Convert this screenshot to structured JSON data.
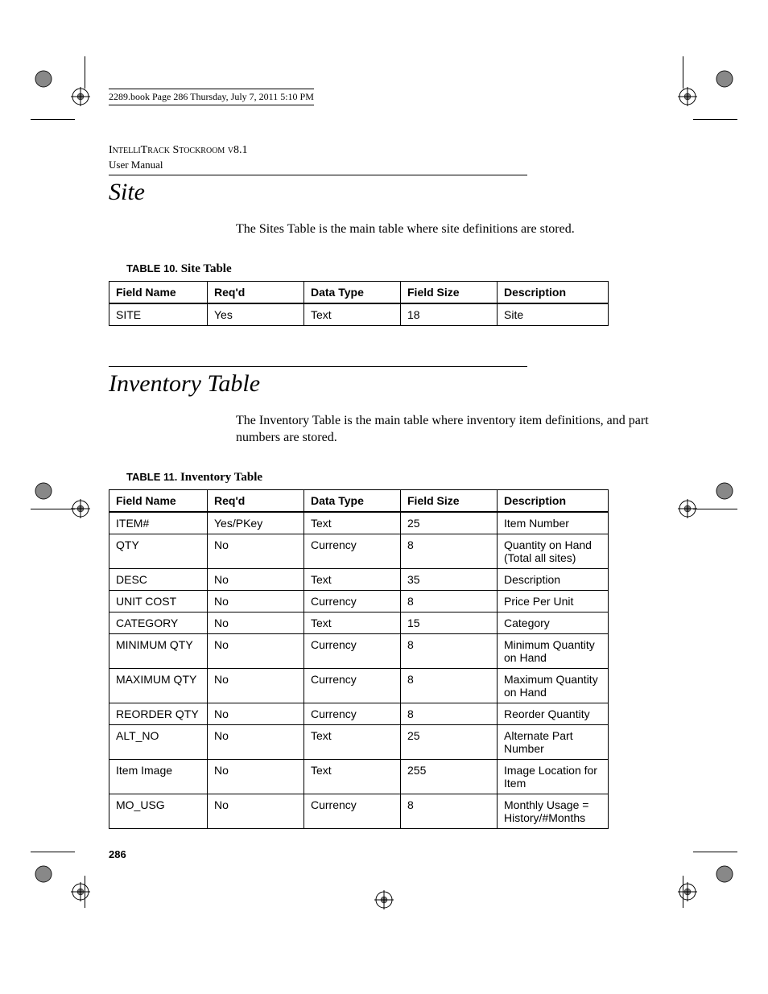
{
  "book_header": "2289.book  Page 286  Thursday, July 7, 2011  5:10 PM",
  "doc_title": "IntelliTrack Stockroom v8.1",
  "doc_subtitle": "User Manual",
  "section1": {
    "title": "Site",
    "body": "The Sites Table is the main table where site definitions are stored.",
    "caption_label": "TABLE 10.",
    "caption_title": "Site Table"
  },
  "section2": {
    "title": "Inventory Table",
    "body": "The Inventory Table is the main table where inventory item definitions, and part numbers are stored.",
    "caption_label": "TABLE 11.",
    "caption_title": "Inventory Table"
  },
  "headers": {
    "field_name": "Field Name",
    "reqd": "Req'd",
    "data_type": "Data Type",
    "field_size": "Field Size",
    "description": "Description"
  },
  "table10_rows": [
    {
      "field_name": "SITE",
      "reqd": "Yes",
      "data_type": "Text",
      "field_size": "18",
      "description": "Site"
    }
  ],
  "table11_rows": [
    {
      "field_name": "ITEM#",
      "reqd": "Yes/PKey",
      "data_type": "Text",
      "field_size": "25",
      "description": "Item Number"
    },
    {
      "field_name": "QTY",
      "reqd": "No",
      "data_type": "Currency",
      "field_size": "8",
      "description": "Quantity on Hand (Total all sites)"
    },
    {
      "field_name": "DESC",
      "reqd": "No",
      "data_type": "Text",
      "field_size": "35",
      "description": "Description"
    },
    {
      "field_name": "UNIT COST",
      "reqd": "No",
      "data_type": "Currency",
      "field_size": "8",
      "description": "Price Per Unit"
    },
    {
      "field_name": "CATEGORY",
      "reqd": "No",
      "data_type": "Text",
      "field_size": "15",
      "description": "Category"
    },
    {
      "field_name": "MINIMUM QTY",
      "reqd": "No",
      "data_type": "Currency",
      "field_size": "8",
      "description": "Minimum Quan­tity on Hand"
    },
    {
      "field_name": "MAXIMUM QTY",
      "reqd": "No",
      "data_type": "Currency",
      "field_size": "8",
      "description": "Maximum Quan­tity on Hand"
    },
    {
      "field_name": "REORDER QTY",
      "reqd": "No",
      "data_type": "Currency",
      "field_size": "8",
      "description": "Reorder Quan­tity"
    },
    {
      "field_name": "ALT_NO",
      "reqd": "No",
      "data_type": "Text",
      "field_size": "25",
      "description": "Alternate Part Number"
    },
    {
      "field_name": "Item Image",
      "reqd": "No",
      "data_type": "Text",
      "field_size": "255",
      "description": "Image Location for Item"
    },
    {
      "field_name": "MO_USG",
      "reqd": "No",
      "data_type": "Currency",
      "field_size": "8",
      "description": "Monthly Usage = History/#Months"
    }
  ],
  "page_number": "286"
}
